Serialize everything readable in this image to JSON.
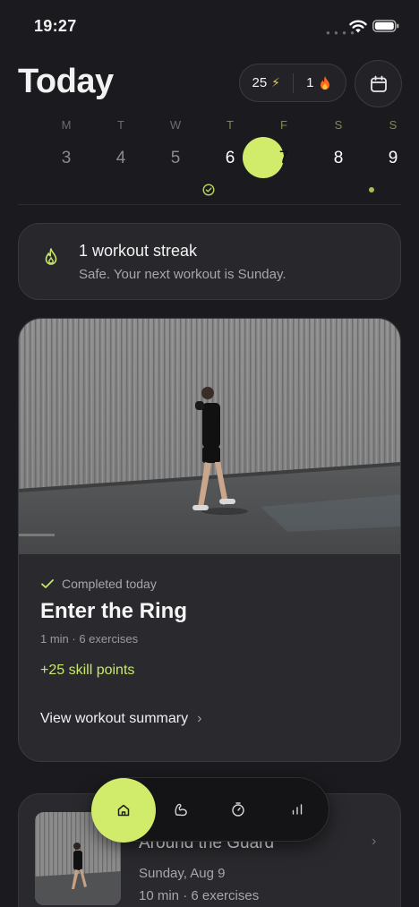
{
  "status_bar": {
    "time": "19:27"
  },
  "header": {
    "title": "Today",
    "stats": {
      "energy": "25",
      "streak": "1"
    }
  },
  "week": [
    {
      "letter": "M",
      "number": "3"
    },
    {
      "letter": "T",
      "number": "4"
    },
    {
      "letter": "W",
      "number": "5"
    },
    {
      "letter": "T",
      "number": "6",
      "mark": "check-circle"
    },
    {
      "letter": "F",
      "number": "7",
      "selected": true
    },
    {
      "letter": "S",
      "number": "8"
    },
    {
      "letter": "S",
      "number": "9",
      "mark": "dot"
    }
  ],
  "streak_card": {
    "title": "1 workout streak",
    "subtitle": "Safe. Your next workout is Sunday.",
    "icon": "flame-icon"
  },
  "workout_card": {
    "status": "Completed today",
    "title": "Enter the Ring",
    "meta": "1 min · 6 exercises",
    "points": "+25 skill points",
    "link": "View workout summary"
  },
  "next_card": {
    "title": "Around the Guard",
    "date": "Sunday, Aug 9",
    "meta": "10 min · 6 exercises"
  },
  "tab_bar": {
    "tabs": [
      "home-icon",
      "flex-arm-icon",
      "timer-icon",
      "stats-icon"
    ],
    "active": "home-icon"
  },
  "colors": {
    "accent": "#d1ec6b",
    "background": "#1b1b1f",
    "card": "#2a2a2e"
  }
}
